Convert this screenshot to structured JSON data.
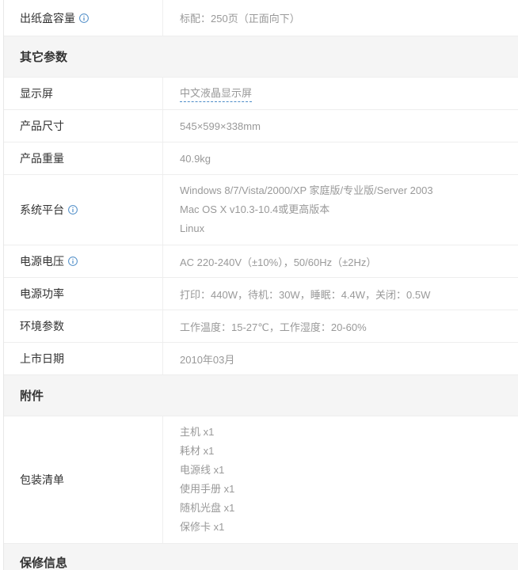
{
  "rows_top": {
    "paper_out": {
      "label": "出纸盒容量",
      "value": "标配：250页（正面向下）"
    }
  },
  "sections": {
    "other": "其它参数",
    "accessories": "附件",
    "warranty": "保修信息"
  },
  "other_params": {
    "display": {
      "label": "显示屏",
      "value": "中文液晶显示屏"
    },
    "size": {
      "label": "产品尺寸",
      "value": "545×599×338mm"
    },
    "weight": {
      "label": "产品重量",
      "value": "40.9kg"
    },
    "os": {
      "label": "系统平台",
      "lines": [
        "Windows 8/7/Vista/2000/XP 家庭版/专业版/Server 2003",
        "Mac OS X v10.3-10.4或更高版本",
        "Linux"
      ]
    },
    "voltage": {
      "label": "电源电压",
      "value": "AC 220-240V（±10%），50/60Hz（±2Hz）"
    },
    "power": {
      "label": "电源功率",
      "value": "打印：440W，待机：30W，睡眠：4.4W，关闭：0.5W"
    },
    "env": {
      "label": "环境参数",
      "value": "工作温度：15-27℃，工作湿度：20-60%"
    },
    "release": {
      "label": "上市日期",
      "value": "2010年03月"
    }
  },
  "accessories": {
    "package": {
      "label": "包装清单",
      "lines": [
        "主机 x1",
        "耗材 x1",
        "电源线 x1",
        "使用手册 x1",
        "随机光盘 x1",
        "保修卡 x1"
      ]
    }
  },
  "colors": {
    "info_icon": "#4d8cc7",
    "section_bg": "#f5f5f5"
  }
}
